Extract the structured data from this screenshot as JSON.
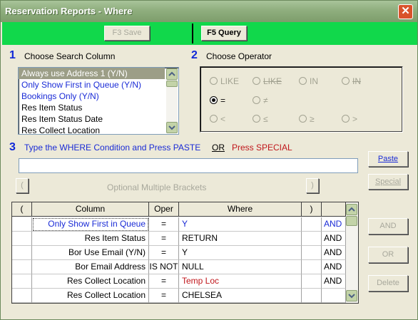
{
  "window": {
    "title": "Reservation Reports - Where",
    "close_glyph": "✕"
  },
  "toolbar": {
    "save_label": "F3 Save",
    "query_label": "F5 Query"
  },
  "step1": {
    "number": "1",
    "label": "Choose Search Column"
  },
  "step2": {
    "number": "2",
    "label": "Choose Operator"
  },
  "step3": {
    "number": "3",
    "label": "Type the WHERE Condition and Press PASTE",
    "or_label": "OR",
    "special_label": "Press SPECIAL"
  },
  "columns_list": {
    "items": [
      {
        "label": "Always use Address 1 (Y/N)",
        "selected": true,
        "highlight": false
      },
      {
        "label": "Only Show First in Queue (Y/N)",
        "selected": false,
        "highlight": true
      },
      {
        "label": "Bookings Only (Y/N)",
        "selected": false,
        "highlight": true
      },
      {
        "label": "Res Item Status",
        "selected": false,
        "highlight": false
      },
      {
        "label": "Res Item Status Date",
        "selected": false,
        "highlight": false
      },
      {
        "label": "Res Collect Location",
        "selected": false,
        "highlight": false
      }
    ]
  },
  "operators": [
    {
      "label": "LIKE",
      "checked": false,
      "strike": false
    },
    {
      "label": "LIKE",
      "checked": false,
      "strike": true
    },
    {
      "label": "IN",
      "checked": false,
      "strike": false
    },
    {
      "label": "IN",
      "checked": false,
      "strike": true
    },
    {
      "label": "=",
      "checked": true,
      "strike": false
    },
    {
      "label": "≠",
      "checked": false,
      "strike": false
    },
    {
      "label": "<",
      "checked": false,
      "strike": false
    },
    {
      "label": "≤",
      "checked": false,
      "strike": false
    },
    {
      "label": "≥",
      "checked": false,
      "strike": false
    },
    {
      "label": ">",
      "checked": false,
      "strike": false
    }
  ],
  "condition": {
    "value": ""
  },
  "buttons": {
    "paste": "Paste",
    "special": "Special",
    "left_bracket": "(",
    "right_bracket": ")",
    "brackets_label": "Optional Multiple Brackets",
    "and": "AND",
    "or": "OR",
    "delete": "Delete"
  },
  "grid": {
    "headers": [
      "(",
      "Column",
      "Oper",
      "Where",
      ")",
      ""
    ],
    "rows": [
      {
        "open": "",
        "column": "Only Show First in Queue",
        "oper": "=",
        "where": "Y",
        "close": "",
        "logic": "AND",
        "column_color": "#1a2bd6",
        "where_color": "#1a2bd6",
        "selected": true
      },
      {
        "open": "",
        "column": "Res Item Status",
        "oper": "=",
        "where": "RETURN",
        "close": "",
        "logic": "AND",
        "column_color": "#000000",
        "where_color": "#000000",
        "selected": false
      },
      {
        "open": "",
        "column": "Bor Use Email (Y/N)",
        "oper": "=",
        "where": "Y",
        "close": "",
        "logic": "AND",
        "column_color": "#000000",
        "where_color": "#000000",
        "selected": false
      },
      {
        "open": "",
        "column": "Bor Email Address",
        "oper": "IS NOT",
        "where": "NULL",
        "close": "",
        "logic": "AND",
        "column_color": "#000000",
        "where_color": "#000000",
        "selected": false
      },
      {
        "open": "",
        "column": "Res Collect Location",
        "oper": "=",
        "where": "Temp Loc",
        "close": "",
        "logic": "AND",
        "column_color": "#000000",
        "where_color": "#c0161b",
        "selected": false
      },
      {
        "open": "",
        "column": "Res Collect Location",
        "oper": "=",
        "where": "CHELSEA",
        "close": "",
        "logic": "",
        "column_color": "#000000",
        "where_color": "#000000",
        "selected": false
      }
    ]
  }
}
